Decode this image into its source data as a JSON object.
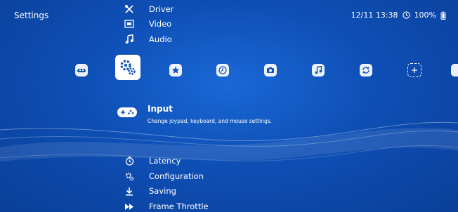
{
  "header": {
    "title": "Settings",
    "datetime": "12/11 13:38",
    "battery": "100%"
  },
  "top_menu": [
    {
      "label": "Driver",
      "icon": "wrench-screwdriver-icon"
    },
    {
      "label": "Video",
      "icon": "video-icon"
    },
    {
      "label": "Audio",
      "icon": "music-note-icon"
    }
  ],
  "tabs": [
    {
      "name": "main-menu",
      "icon": "retroarch-invader-icon"
    },
    {
      "name": "settings",
      "icon": "gears-icon",
      "active": true
    },
    {
      "name": "favorites",
      "icon": "star-icon"
    },
    {
      "name": "history",
      "icon": "clock-icon"
    },
    {
      "name": "images",
      "icon": "camera-icon"
    },
    {
      "name": "music",
      "icon": "music-icon"
    },
    {
      "name": "netplay",
      "icon": "netplay-icon"
    },
    {
      "name": "add",
      "icon": "plus-icon"
    }
  ],
  "selected_item": {
    "label": "Input",
    "description": "Change joypad, keyboard, and mouse settings.",
    "icon": "gamepad-icon"
  },
  "bottom_menu": [
    {
      "label": "Latency",
      "icon": "stopwatch-icon"
    },
    {
      "label": "Configuration",
      "icon": "gears-small-icon"
    },
    {
      "label": "Saving",
      "icon": "download-icon"
    },
    {
      "label": "Frame Throttle",
      "icon": "fast-forward-icon"
    }
  ],
  "colors": {
    "background_top": "#1a68d6",
    "background_bottom": "#0a3f99",
    "text": "#ffffff"
  }
}
